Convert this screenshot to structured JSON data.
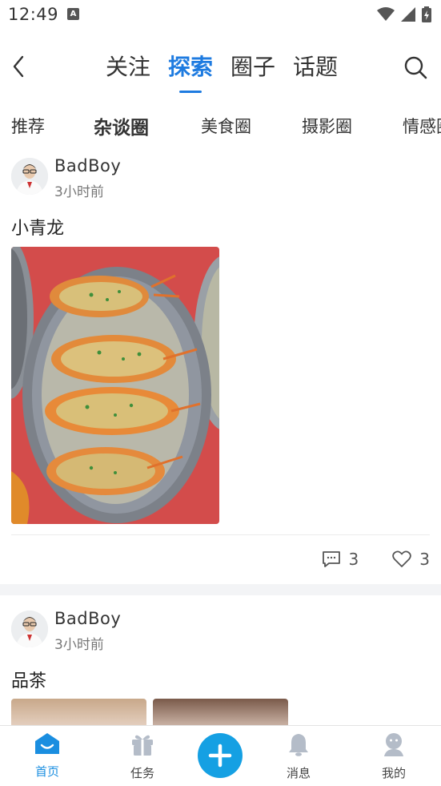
{
  "status_bar": {
    "time": "12:49",
    "notification_icon": "A"
  },
  "top_nav": {
    "tabs": [
      {
        "label": "关注",
        "active": false
      },
      {
        "label": "探索",
        "active": true
      },
      {
        "label": "圈子",
        "active": false
      },
      {
        "label": "话题",
        "active": false
      }
    ]
  },
  "sub_tabs": [
    {
      "label": "推荐",
      "active": false
    },
    {
      "label": "杂谈圈",
      "active": true
    },
    {
      "label": "美食圈",
      "active": false
    },
    {
      "label": "摄影圈",
      "active": false
    },
    {
      "label": "情感圈",
      "active": false
    }
  ],
  "posts": [
    {
      "author": "BadBoy",
      "time": "3小时前",
      "text": "小青龙",
      "comments": "3",
      "likes": "3"
    },
    {
      "author": "BadBoy",
      "time": "3小时前",
      "text": "品茶"
    }
  ],
  "bottom_nav": {
    "items": [
      {
        "label": "首页",
        "icon": "home-icon",
        "active": true
      },
      {
        "label": "任务",
        "icon": "gift-icon",
        "active": false
      },
      {
        "label": "消息",
        "icon": "bell-icon",
        "active": false
      },
      {
        "label": "我的",
        "icon": "user-icon",
        "active": false
      }
    ]
  },
  "colors": {
    "accent": "#1e7be0",
    "fab": "#15a0e3",
    "tab_active": "#1a8ee0"
  }
}
